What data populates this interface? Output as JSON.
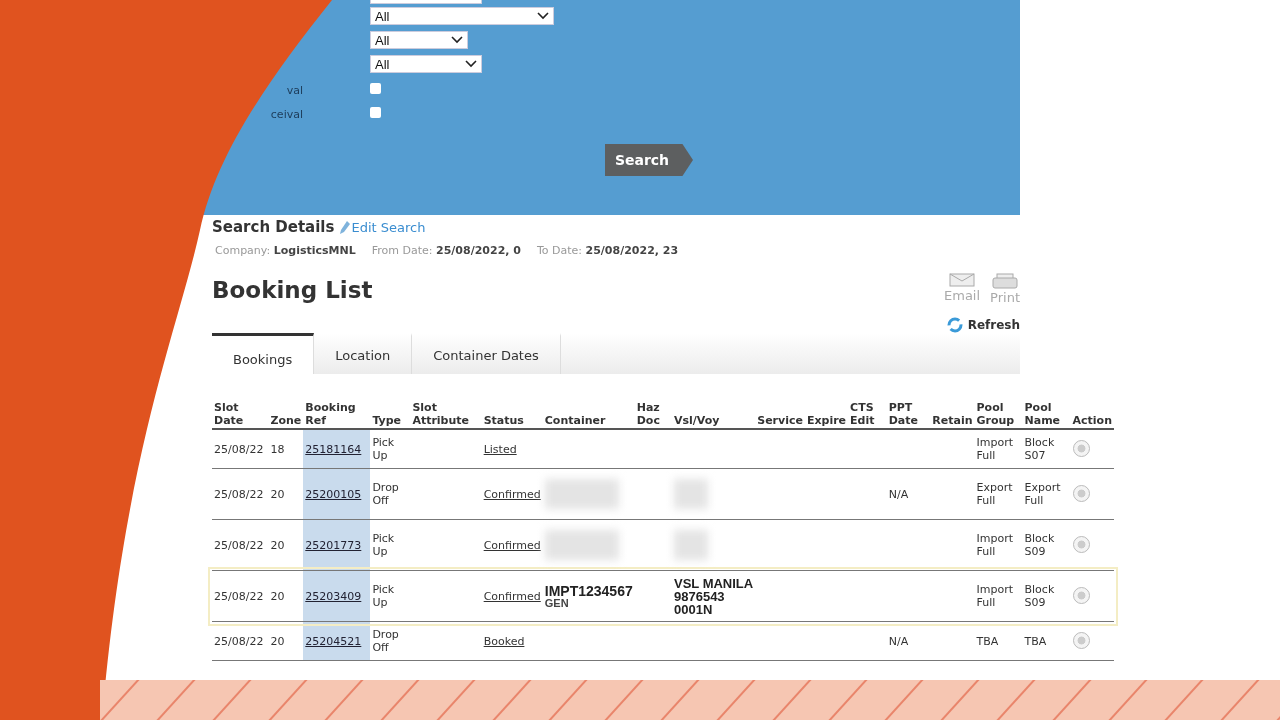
{
  "search_panel": {
    "selects": [
      {
        "value": "All"
      },
      {
        "value": "All"
      },
      {
        "value": "All"
      }
    ],
    "checkbox_rows": [
      {
        "label": "val",
        "checked": false
      },
      {
        "label": "ceival",
        "checked": false
      }
    ],
    "search_button": "Search"
  },
  "search_details": {
    "title": "Search Details",
    "edit_link": "Edit Search",
    "fields": [
      {
        "label": "Company:",
        "value": "LogisticsMNL"
      },
      {
        "label": "From Date:",
        "value": "25/08/2022, 0"
      },
      {
        "label": "To Date:",
        "value": "25/08/2022, 23"
      }
    ]
  },
  "booking_list": {
    "title": "Booking List",
    "actions": [
      {
        "kind": "email",
        "label": "Email"
      },
      {
        "kind": "print",
        "label": "Print"
      }
    ],
    "refresh": "Refresh",
    "tabs": [
      {
        "label": "Bookings",
        "selected": true
      },
      {
        "label": "Location",
        "selected": false
      },
      {
        "label": "Container Dates",
        "selected": false
      }
    ]
  },
  "table": {
    "columns": [
      "Slot Date",
      "Zone",
      "Booking Ref",
      "Type",
      "Slot Attribute",
      "Status",
      "Container",
      "Haz Doc",
      "Vsl/Voy",
      "Service",
      "Expire",
      "CTS Edit",
      "PPT Date",
      "Retain",
      "Pool Group",
      "Pool Name",
      "Action"
    ],
    "rows": [
      {
        "slot_date": "25/08/22",
        "zone": "18",
        "booking_ref": "25181164",
        "type": "Pick Up",
        "status": "Listed",
        "pool_group": "Import Full",
        "pool_name": "Block S07",
        "selected": false
      },
      {
        "slot_date": "25/08/22",
        "zone": "20",
        "booking_ref": "25200105",
        "type": "Drop Off",
        "status": "Confirmed",
        "container": {
          "kind": "blurred"
        },
        "vsl_voy": {
          "kind": "blurred"
        },
        "ppt_date": "N/A",
        "pool_group": "Export Full",
        "pool_name": "Export Full",
        "selected": false
      },
      {
        "slot_date": "25/08/22",
        "zone": "20",
        "booking_ref": "25201773",
        "type": "Pick Up",
        "status": "Confirmed",
        "container": {
          "kind": "blurred"
        },
        "vsl_voy": {
          "kind": "blurred"
        },
        "pool_group": "Import Full",
        "pool_name": "Block S09",
        "selected": false
      },
      {
        "slot_date": "25/08/22",
        "zone": "20",
        "booking_ref": "25203409",
        "type": "Pick Up",
        "status": "Confirmed",
        "container": {
          "kind": "text",
          "number": "IMPT1234567",
          "sub": "GEN"
        },
        "vsl_voy": {
          "kind": "text",
          "lines": [
            "VSL MANILA",
            "9876543",
            "0001N"
          ]
        },
        "pool_group": "Import Full",
        "pool_name": "Block S09",
        "selected": true
      },
      {
        "slot_date": "25/08/22",
        "zone": "20",
        "booking_ref": "25204521",
        "type": "Drop Off",
        "status": "Booked",
        "ppt_date": "N/A",
        "pool_group": "TBA",
        "pool_name": "TBA",
        "selected": false
      }
    ]
  }
}
